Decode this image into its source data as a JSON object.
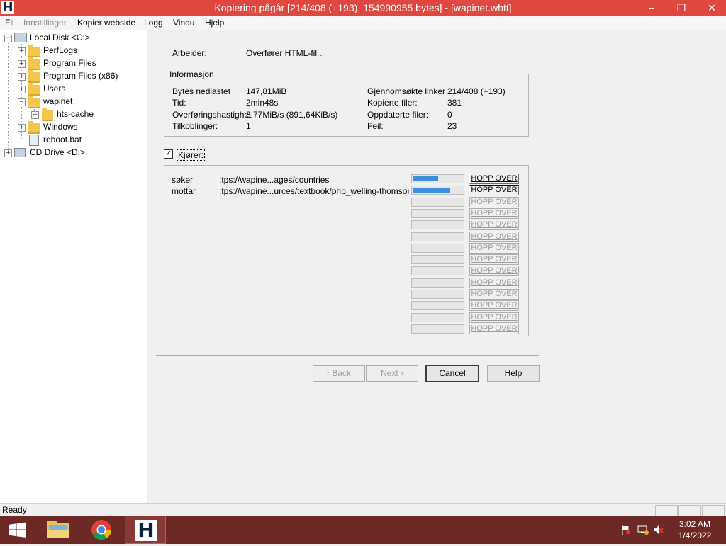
{
  "window": {
    "title": "Kopiering pågår [214/408 (+193), 154990955 bytes] - [wapinet.whtt]",
    "minimize": "–",
    "restore": "❐",
    "close": "✕"
  },
  "menu": [
    "Fil",
    "Innstillinger",
    "Kopier webside",
    "Logg",
    "Vindu",
    "Hjelp"
  ],
  "tree": {
    "root": "Local Disk <C:>",
    "items": [
      "PerfLogs",
      "Program Files",
      "Program Files (x86)",
      "Users",
      "wapinet",
      "hts-cache",
      "Windows",
      "reboot.bat"
    ],
    "cd": "CD Drive <D:>"
  },
  "work": {
    "label": "Arbeider:",
    "value": "Overfører HTML-fil..."
  },
  "info": {
    "title": "Informasjon",
    "left": [
      {
        "label": "Bytes nedlastet",
        "value": "147,81MiB"
      },
      {
        "label": "Tid:",
        "value": "2min48s"
      },
      {
        "label": "Overføringshastighet",
        "value": "8,77MiB/s (891,64KiB/s)"
      },
      {
        "label": "Tilkoblinger:",
        "value": "1"
      }
    ],
    "right": [
      {
        "label": "Gjennomsøkte linker",
        "value": "214/408 (+193)"
      },
      {
        "label": "Kopierte filer:",
        "value": "381"
      },
      {
        "label": "Oppdaterte filer:",
        "value": "0"
      },
      {
        "label": "Feil:",
        "value": "23"
      }
    ]
  },
  "running": {
    "label": "Kjører:",
    "checked": "✓"
  },
  "transfers": [
    {
      "status": "søker",
      "url": ":tps://wapine...ages/countries",
      "progress": 0.5
    },
    {
      "status": "mottar",
      "url": ":tps://wapine...urces/textbook/php_welling-thomson.pdf",
      "progress": 0.75
    }
  ],
  "skip_label": "HOPP OVER",
  "buttons": {
    "back": "‹ Back",
    "next": "Next ›",
    "cancel": "Cancel",
    "help": "Help"
  },
  "status": "Ready",
  "clock": {
    "time": "3:02 AM",
    "date": "1/4/2022"
  },
  "taskbar": {
    "app_letter": "H"
  }
}
